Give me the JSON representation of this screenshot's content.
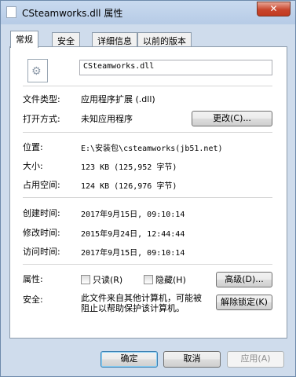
{
  "window": {
    "title": "CSteamworks.dll 属性",
    "close_label": "✕"
  },
  "tabs": [
    "常规",
    "安全",
    "详细信息",
    "以前的版本"
  ],
  "file": {
    "name": "CSteamworks.dll",
    "icon": "dll-file-icon"
  },
  "rows": {
    "type": {
      "label": "文件类型:",
      "value": "应用程序扩展 (.dll)"
    },
    "open_with": {
      "label": "打开方式:",
      "value": "未知应用程序",
      "button": "更改(C)..."
    },
    "location": {
      "label": "位置:",
      "value": "E:\\安装包\\csteamworks(jb51.net)"
    },
    "size": {
      "label": "大小:",
      "value": "123 KB (125,952 字节)"
    },
    "size_on_disk": {
      "label": "占用空间:",
      "value": "124 KB (126,976 字节)"
    },
    "created": {
      "label": "创建时间:",
      "value": "2017年9月15日, 09:10:14"
    },
    "modified": {
      "label": "修改时间:",
      "value": "2015年9月24日, 12:44:44"
    },
    "accessed": {
      "label": "访问时间:",
      "value": "2017年9月15日, 09:10:14"
    }
  },
  "attributes": {
    "label": "属性:",
    "readonly": "只读(R)",
    "hidden": "隐藏(H)",
    "advanced_button": "高级(D)..."
  },
  "security": {
    "label": "安全:",
    "text": "此文件来自其他计算机，可能被阻止以帮助保护该计算机。",
    "unblock_button": "解除锁定(K)"
  },
  "buttons": {
    "ok": "确定",
    "cancel": "取消",
    "apply": "应用(A)"
  }
}
